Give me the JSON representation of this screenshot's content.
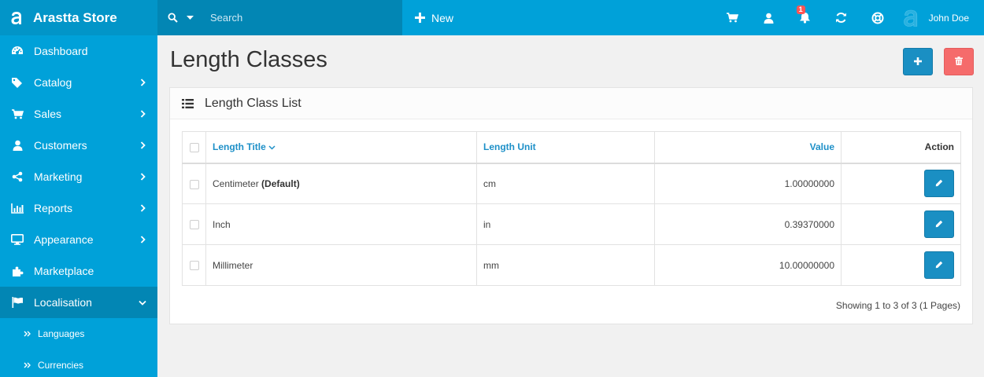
{
  "brand": {
    "name": "Arastta Store"
  },
  "sidebar": {
    "items": [
      {
        "label": "Dashboard",
        "icon": "dashboard-icon",
        "has_children": false
      },
      {
        "label": "Catalog",
        "icon": "tags-icon",
        "has_children": true
      },
      {
        "label": "Sales",
        "icon": "cart-icon",
        "has_children": true
      },
      {
        "label": "Customers",
        "icon": "user-icon",
        "has_children": true
      },
      {
        "label": "Marketing",
        "icon": "share-icon",
        "has_children": true
      },
      {
        "label": "Reports",
        "icon": "bar-chart-icon",
        "has_children": true
      },
      {
        "label": "Appearance",
        "icon": "desktop-icon",
        "has_children": true
      },
      {
        "label": "Marketplace",
        "icon": "puzzle-icon",
        "has_children": false
      },
      {
        "label": "Localisation",
        "icon": "flag-icon",
        "has_children": true,
        "expanded": true
      }
    ],
    "subitems": [
      {
        "label": "Languages"
      },
      {
        "label": "Currencies"
      }
    ]
  },
  "topbar": {
    "search_placeholder": "Search",
    "new_label": "New",
    "notification_count": "1",
    "user_name": "John Doe"
  },
  "page": {
    "title": "Length Classes"
  },
  "panel": {
    "title": "Length Class List"
  },
  "table": {
    "headers": {
      "title": "Length Title",
      "unit": "Length Unit",
      "value": "Value",
      "action": "Action"
    },
    "rows": [
      {
        "title": "Centimeter",
        "default_tag": "(Default)",
        "unit": "cm",
        "value": "1.00000000"
      },
      {
        "title": "Inch",
        "default_tag": "",
        "unit": "in",
        "value": "0.39370000"
      },
      {
        "title": "Millimeter",
        "default_tag": "",
        "unit": "mm",
        "value": "10.00000000"
      }
    ]
  },
  "pagination": {
    "info": "Showing 1 to 3 of 3 (1 Pages)"
  },
  "colors": {
    "sidebar": "#00a1d9",
    "sidebar_active": "#0286b4",
    "primary_button": "#1a8fc3",
    "danger_button": "#f56b6b",
    "link": "#1e90c8",
    "badge": "#ff5555"
  }
}
